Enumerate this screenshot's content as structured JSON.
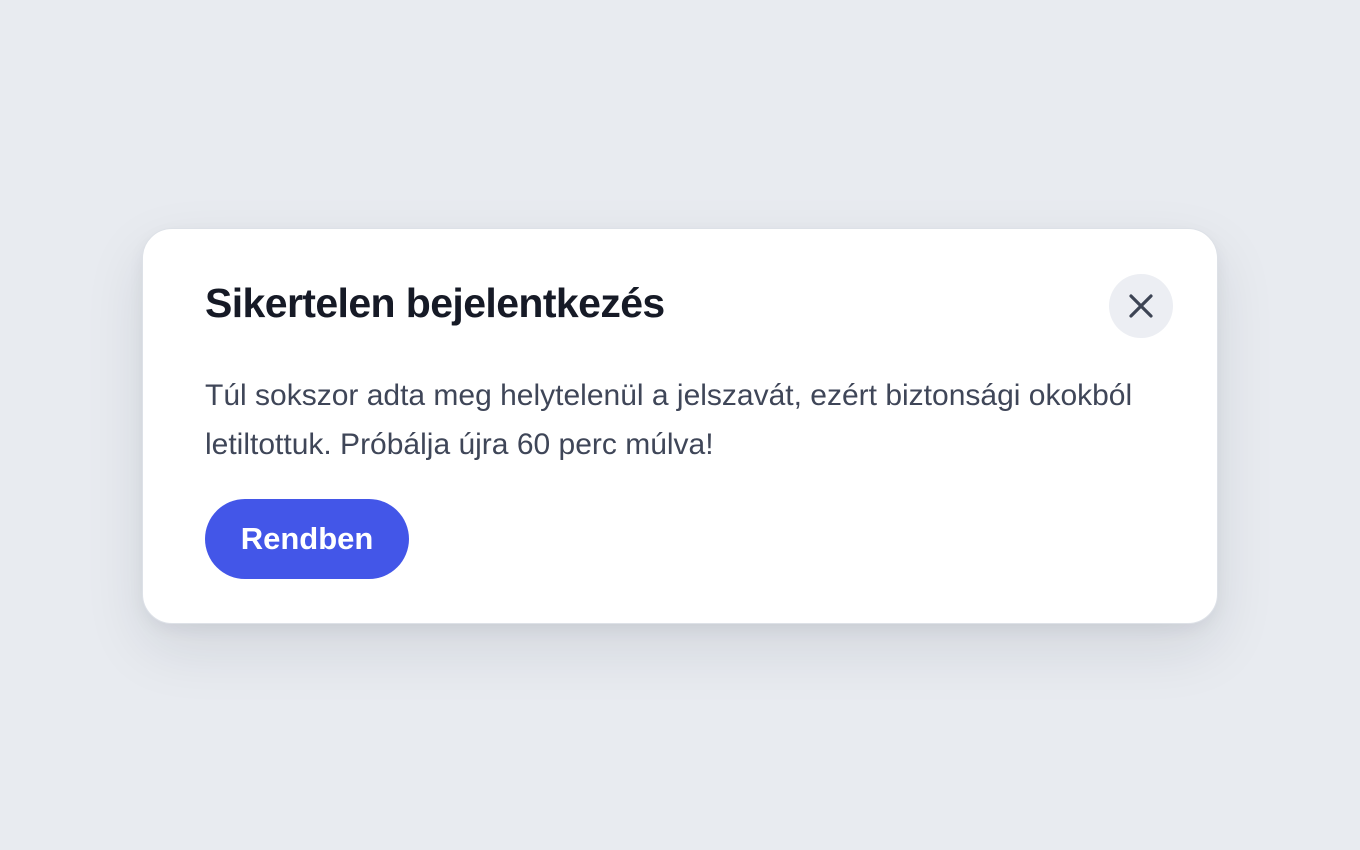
{
  "dialog": {
    "title": "Sikertelen bejelentkezés",
    "message": "Túl sokszor adta meg helytelenül a jelszavát, ezért biztonsági okokból letiltottuk. Próbálja újra 60 perc múlva!",
    "close_icon": "close-icon",
    "confirm_label": "Rendben"
  },
  "colors": {
    "background": "#e8ebf0",
    "surface": "#ffffff",
    "title": "#161a26",
    "text": "#3f4658",
    "accent": "#4356e8",
    "close_button_bg": "#eceef3"
  }
}
